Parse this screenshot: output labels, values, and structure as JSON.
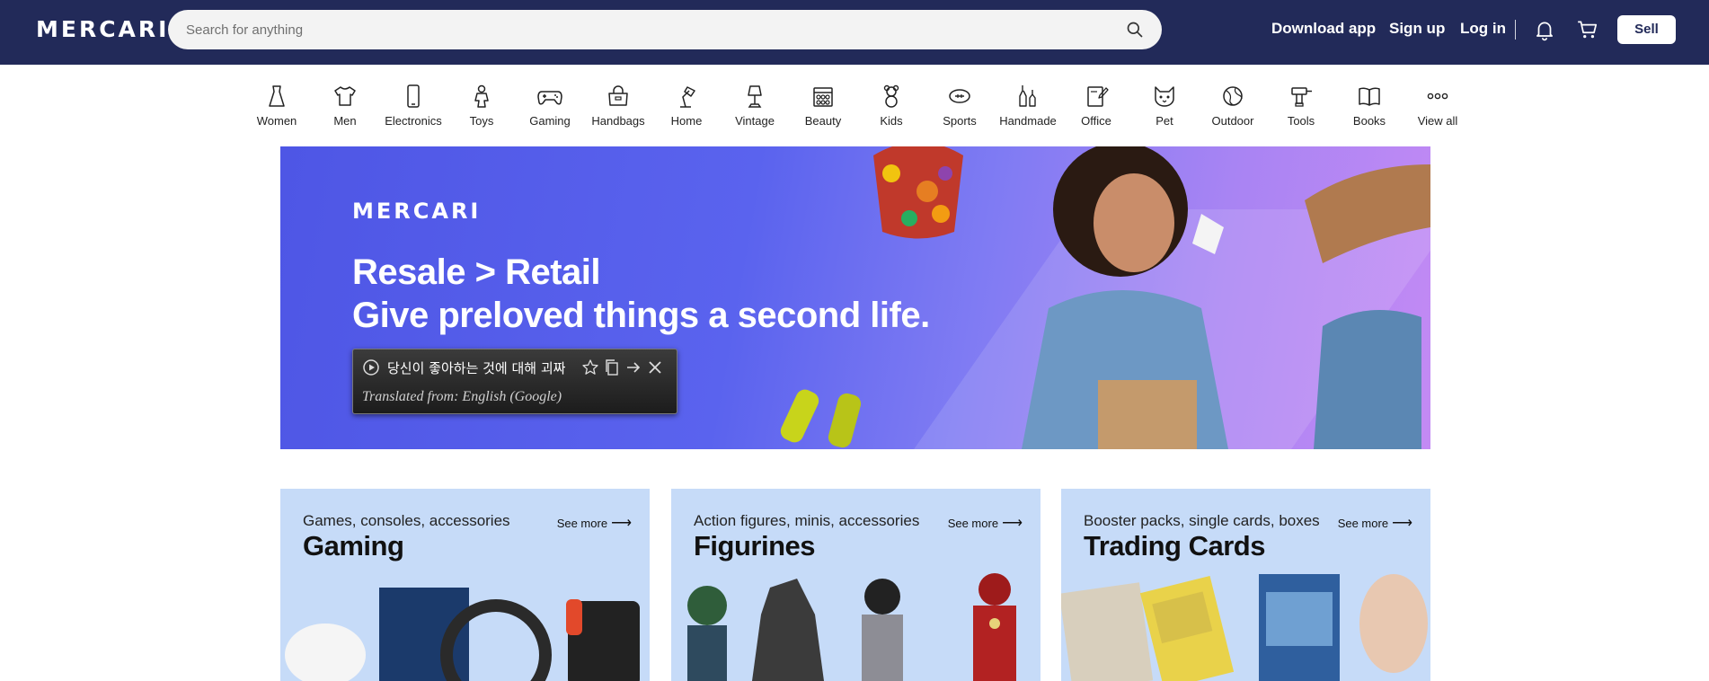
{
  "header": {
    "logo": "MERCARI",
    "search_placeholder": "Search for anything",
    "download_app": "Download app",
    "sign_up": "Sign up",
    "log_in": "Log in",
    "sell": "Sell"
  },
  "categories": [
    {
      "label": "Women",
      "icon": "dress-icon"
    },
    {
      "label": "Men",
      "icon": "tshirt-icon"
    },
    {
      "label": "Electronics",
      "icon": "phone-icon"
    },
    {
      "label": "Toys",
      "icon": "toy-robot-icon"
    },
    {
      "label": "Gaming",
      "icon": "gamepad-icon"
    },
    {
      "label": "Handbags",
      "icon": "handbag-icon"
    },
    {
      "label": "Home",
      "icon": "lamp-icon"
    },
    {
      "label": "Vintage",
      "icon": "vintage-lamp-icon"
    },
    {
      "label": "Beauty",
      "icon": "makeup-palette-icon"
    },
    {
      "label": "Kids",
      "icon": "teddy-bear-icon"
    },
    {
      "label": "Sports",
      "icon": "football-icon"
    },
    {
      "label": "Handmade",
      "icon": "craft-bottle-icon"
    },
    {
      "label": "Office",
      "icon": "notepad-icon"
    },
    {
      "label": "Pet",
      "icon": "cat-face-icon"
    },
    {
      "label": "Outdoor",
      "icon": "globe-icon"
    },
    {
      "label": "Tools",
      "icon": "drill-icon"
    },
    {
      "label": "Books",
      "icon": "book-icon"
    },
    {
      "label": "View all",
      "icon": "more-dots-icon"
    }
  ],
  "hero": {
    "logo": "MERCARI",
    "headline_1": "Resale > Retail",
    "headline_2": "Give preloved things a second life.",
    "translation_popup": {
      "translated_text": "당신이 좋아하는 것에 대해 괴짜",
      "source": "Translated from: English (Google)"
    }
  },
  "cards": [
    {
      "subtitle": "Games, consoles, accessories",
      "title": "Gaming",
      "see_more": "See more"
    },
    {
      "subtitle": "Action figures, minis, accessories",
      "title": "Figurines",
      "see_more": "See more"
    },
    {
      "subtitle": "Booster packs, single cards, boxes",
      "title": "Trading Cards",
      "see_more": "See more"
    }
  ],
  "colors": {
    "header_bg": "#222a59",
    "hero_gradient_start": "#4e56e5",
    "hero_gradient_end": "#c38af4",
    "card_bg": "#c6dbf8"
  }
}
